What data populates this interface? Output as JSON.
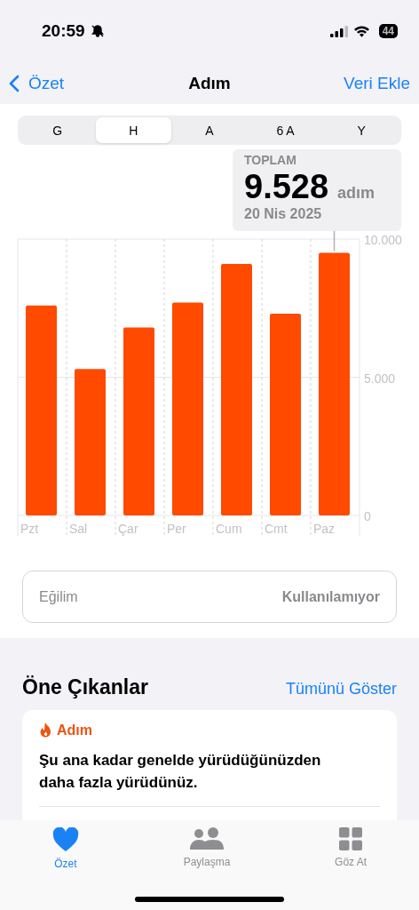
{
  "status_bar": {
    "time": "20:59",
    "battery": "44"
  },
  "nav": {
    "back": "Özet",
    "title": "Adım",
    "action": "Veri Ekle"
  },
  "segments": [
    {
      "label": "G",
      "selected": false
    },
    {
      "label": "H",
      "selected": true
    },
    {
      "label": "A",
      "selected": false
    },
    {
      "label": "6 A",
      "selected": false
    },
    {
      "label": "Y",
      "selected": false
    }
  ],
  "summary": {
    "label": "TOPLAM",
    "value": "9.528",
    "unit": "adım",
    "date": "20 Nis 2025"
  },
  "chart_data": {
    "type": "bar",
    "categories": [
      "Pzt",
      "Sal",
      "Çar",
      "Per",
      "Cum",
      "Cmt",
      "Paz"
    ],
    "series": [
      {
        "color": "#ff4a00",
        "values": [
          7600,
          5300,
          6800,
          7700,
          9100,
          7300,
          9500
        ]
      }
    ],
    "ylim": [
      0,
      10000
    ],
    "yticks": [
      {
        "value": 0,
        "label": "0"
      },
      {
        "value": 5000,
        "label": "5.000"
      },
      {
        "value": 10000,
        "label": "10.000"
      }
    ]
  },
  "trend": {
    "label": "Eğilim",
    "value": "Kullanılamıyor"
  },
  "highlights": {
    "title": "Öne Çıkanlar",
    "link": "Tümünü Göster",
    "card": {
      "category": "Adım",
      "text": "Şu ana kadar genelde yürüdüğünüzden daha fazla yürüdünüz."
    }
  },
  "tab_bar": [
    {
      "label": "Özet",
      "selected": true
    },
    {
      "label": "Paylaşma",
      "selected": false
    },
    {
      "label": "Göz At",
      "selected": false
    }
  ]
}
